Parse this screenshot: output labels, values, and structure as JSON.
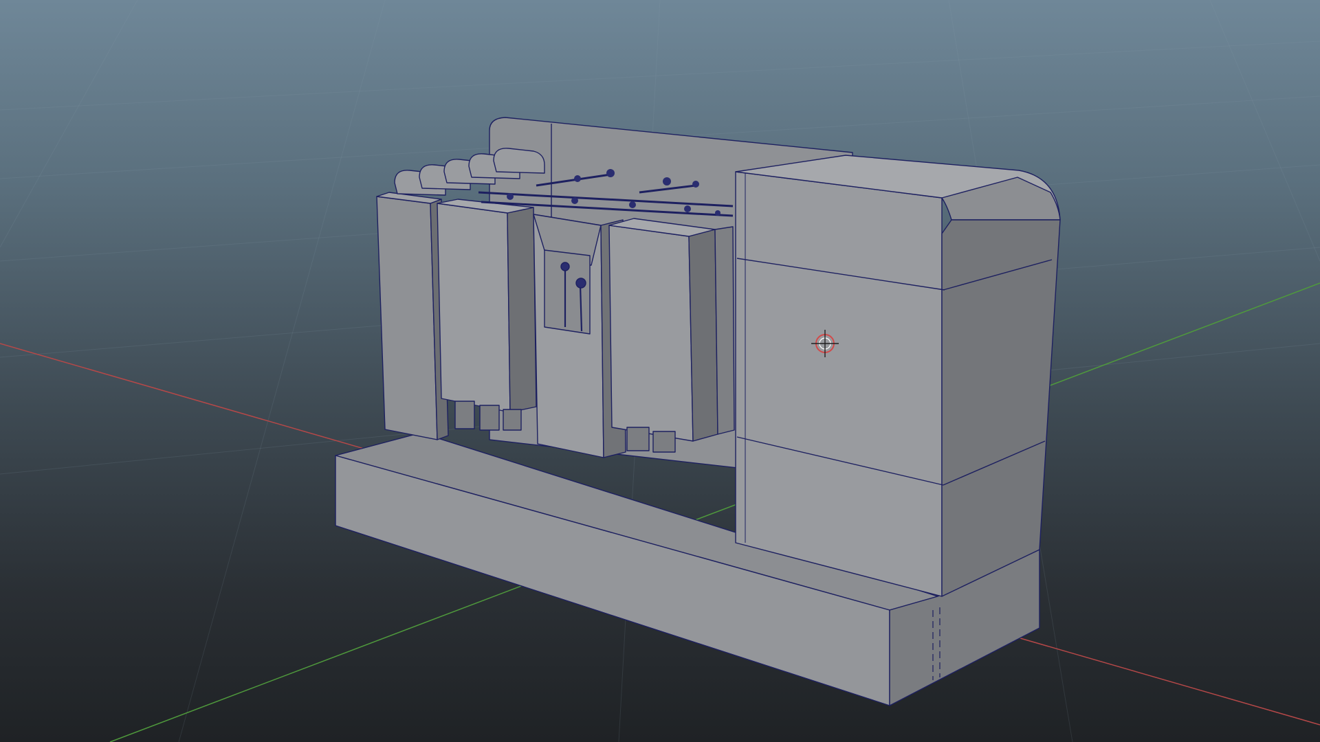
{
  "viewport": {
    "kind": "3d-perspective-viewport",
    "background_top": "#6f8798",
    "background_bottom": "#1f2225"
  },
  "colors": {
    "mesh_fill": "#8d8f93",
    "mesh_light": "#a2a4a8",
    "mesh_dark": "#6c6e72",
    "wire": "#1d2060",
    "x_axis": "#b64848",
    "z_axis": "#4f9a3c",
    "grid": "#7a8c99",
    "manipulator": "#d24a4a"
  },
  "icons": {
    "pivot": "crosshair-pivot-icon"
  }
}
